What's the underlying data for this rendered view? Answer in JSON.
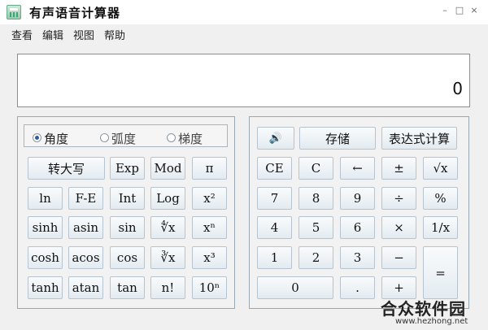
{
  "window": {
    "title": "有声语音计算器",
    "controls": [
      "–",
      "□",
      "×"
    ]
  },
  "menu": [
    "查看",
    "编辑",
    "视图",
    "帮助"
  ],
  "display": {
    "value": "0"
  },
  "angle_mode": {
    "options": [
      "角度",
      "弧度",
      "梯度"
    ],
    "selected": "角度"
  },
  "scientific_buttons": {
    "row1": [
      "转大写",
      "Exp",
      "Mod",
      "π"
    ],
    "row2": [
      "ln",
      "F-E",
      "Int",
      "Log",
      "x²"
    ],
    "row3": [
      "sinh",
      "asin",
      "sin",
      "∜x",
      "xⁿ"
    ],
    "row4": [
      "cosh",
      "acos",
      "cos",
      "∛x",
      "x³"
    ],
    "row5": [
      "tanh",
      "atan",
      "tan",
      "n!",
      "10ⁿ"
    ]
  },
  "standard_buttons": {
    "top": [
      "🔊",
      "存储",
      "表达式计算"
    ],
    "row1": [
      "CE",
      "C",
      "←",
      "±",
      "√x"
    ],
    "row2": [
      "7",
      "8",
      "9",
      "÷",
      "%"
    ],
    "row3": [
      "4",
      "5",
      "6",
      "×",
      "1/x"
    ],
    "row4": [
      "1",
      "2",
      "3",
      "−"
    ],
    "row5": [
      "0",
      ".",
      "+"
    ],
    "equals": "="
  },
  "watermark": {
    "logo": "合众软件园",
    "url": "www.hezhong.net"
  }
}
